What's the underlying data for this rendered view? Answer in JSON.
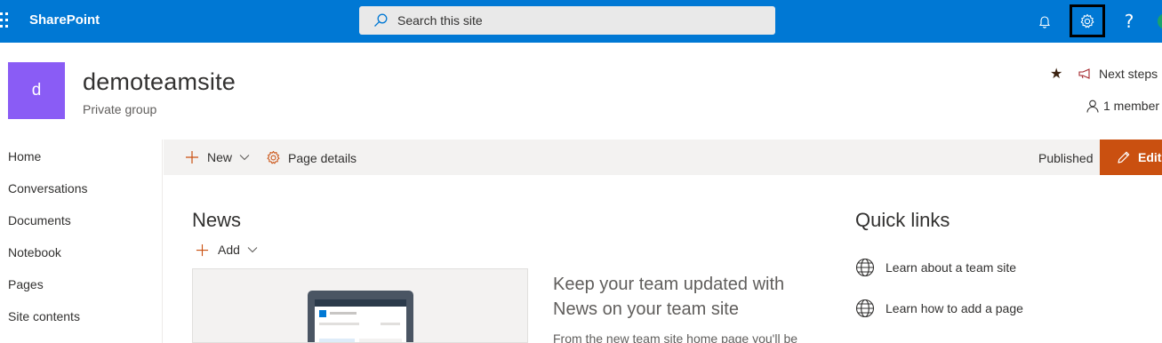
{
  "suitebar": {
    "app_name": "SharePoint",
    "search_placeholder": "Search this site",
    "icons": [
      "app-launcher-icon",
      "search-icon",
      "bell-icon",
      "gear-icon",
      "help-icon"
    ],
    "help_glyph": "?",
    "accent": "#0078d4"
  },
  "site": {
    "logo_letter": "d",
    "logo_color": "#8a5cf5",
    "title": "demoteamsite",
    "subtitle": "Private group",
    "follow_glyph": "★",
    "next_steps": "Next steps",
    "members": "1 member"
  },
  "leftnav": {
    "items": [
      {
        "label": "Home"
      },
      {
        "label": "Conversations"
      },
      {
        "label": "Documents"
      },
      {
        "label": "Notebook"
      },
      {
        "label": "Pages"
      },
      {
        "label": "Site contents"
      }
    ]
  },
  "commandbar": {
    "new_label": "New",
    "page_details_label": "Page details",
    "status": "Published",
    "edit_label": "Edit",
    "edit_color": "#ca5010"
  },
  "news": {
    "title": "News",
    "add_label": "Add",
    "headline": "Keep your team updated with News on your team site",
    "body": "From the new team site home page you'll be"
  },
  "quick_links": {
    "title": "Quick links",
    "items": [
      {
        "label": "Learn about a team site"
      },
      {
        "label": "Learn how to add a page"
      }
    ]
  }
}
